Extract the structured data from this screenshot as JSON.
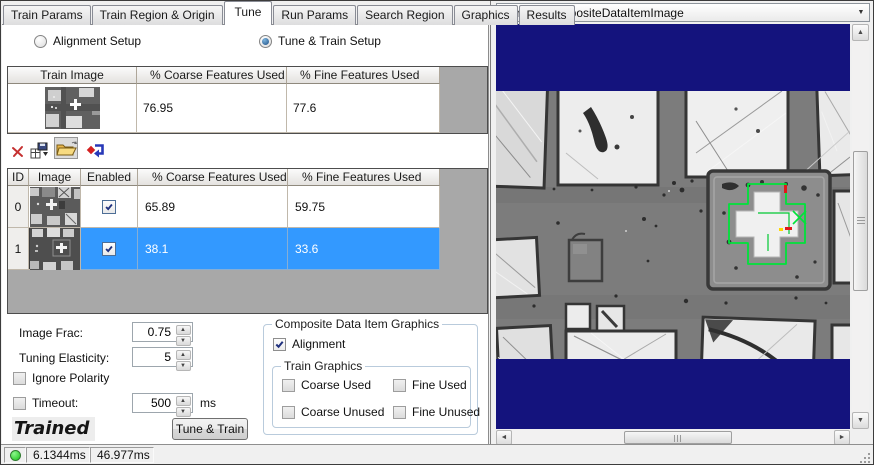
{
  "tabs": {
    "items": [
      "Train Params",
      "Train Region & Origin",
      "Tune",
      "Run Params",
      "Search Region",
      "Graphics",
      "Results"
    ],
    "active": "Tune"
  },
  "setup_radios": {
    "alignment": "Alignment Setup",
    "tune_train": "Tune & Train Setup",
    "selected": "Tune & Train Setup"
  },
  "train_table": {
    "columns": [
      "Train Image",
      "% Coarse Features Used",
      "% Fine Features Used"
    ],
    "row": {
      "coarse": "76.95",
      "fine": "77.6"
    }
  },
  "toolbar": {
    "icons": [
      "delete-icon",
      "image-database-icon",
      "open-folder-icon",
      "import-icon"
    ]
  },
  "images_table": {
    "columns": [
      "ID",
      "Image",
      "Enabled",
      "% Coarse Features Used",
      "% Fine Features Used"
    ],
    "rows": [
      {
        "id": "0",
        "enabled": true,
        "coarse": "65.89",
        "fine": "59.75",
        "selected": false
      },
      {
        "id": "1",
        "enabled": true,
        "coarse": "38.1",
        "fine": "33.6",
        "selected": true
      }
    ]
  },
  "params": {
    "image_frac": {
      "label": "Image Frac:",
      "value": "0.75"
    },
    "tuning_elasticity": {
      "label": "Tuning Elasticity:",
      "value": "5"
    },
    "ignore_polarity": {
      "label": "Ignore Polarity",
      "checked": false
    },
    "timeout": {
      "label": "Timeout:",
      "value": "500",
      "units": "ms",
      "checked": false
    }
  },
  "graphics": {
    "group_title": "Composite Data Item Graphics",
    "alignment": {
      "label": "Alignment",
      "checked": true
    },
    "train_group_title": "Train Graphics",
    "options": [
      {
        "label": "Coarse Used",
        "checked": false
      },
      {
        "label": "Fine Used",
        "checked": false
      },
      {
        "label": "Coarse Unused",
        "checked": false
      },
      {
        "label": "Fine Unused",
        "checked": false
      }
    ]
  },
  "state_label": "Trained",
  "tune_train_button": "Tune & Train",
  "status_bar": {
    "time1": "6.1344ms",
    "time2": "46.977ms",
    "indicator_color": "#17c117"
  },
  "image_panel": {
    "selector": "Current.CompositeDataItemImage"
  },
  "colors": {
    "selection": "#3399ff",
    "display_background": "#14137d",
    "overlay_green": "#00e23a"
  }
}
